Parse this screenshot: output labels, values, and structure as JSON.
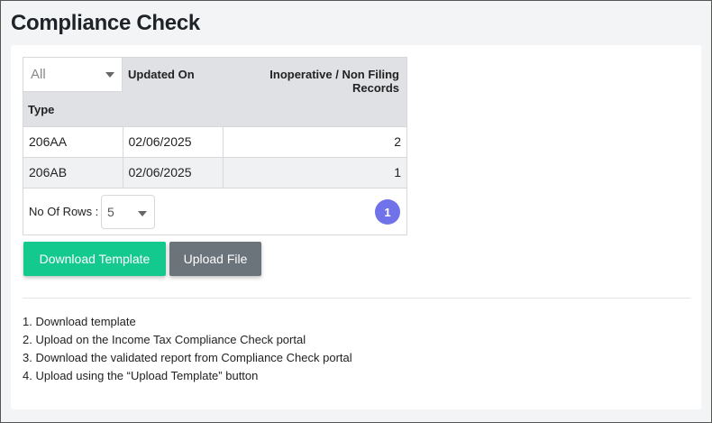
{
  "page": {
    "title": "Compliance Check"
  },
  "table": {
    "type_filter": {
      "selected": "All"
    },
    "headers": {
      "type": "Type",
      "updated_on": "Updated On",
      "records": "Inoperative / Non Filing Records"
    },
    "rows": [
      {
        "type": "206AA",
        "updated_on": "02/06/2025",
        "records": "2"
      },
      {
        "type": "206AB",
        "updated_on": "02/06/2025",
        "records": "1"
      }
    ],
    "pager": {
      "rows_label": "No Of Rows :",
      "rows_value": "5",
      "current_page": "1"
    }
  },
  "actions": {
    "download_label": "Download Template",
    "upload_label": "Upload File"
  },
  "instructions": [
    "1. Download template",
    "2. Upload on the Income Tax Compliance Check portal",
    "3. Download the validated report from Compliance Check portal",
    "4. Upload using the “Upload Template” button"
  ],
  "colors": {
    "primary_button": "#14c98d",
    "secondary_button": "#6b737b",
    "page_badge": "#6f72e8"
  }
}
